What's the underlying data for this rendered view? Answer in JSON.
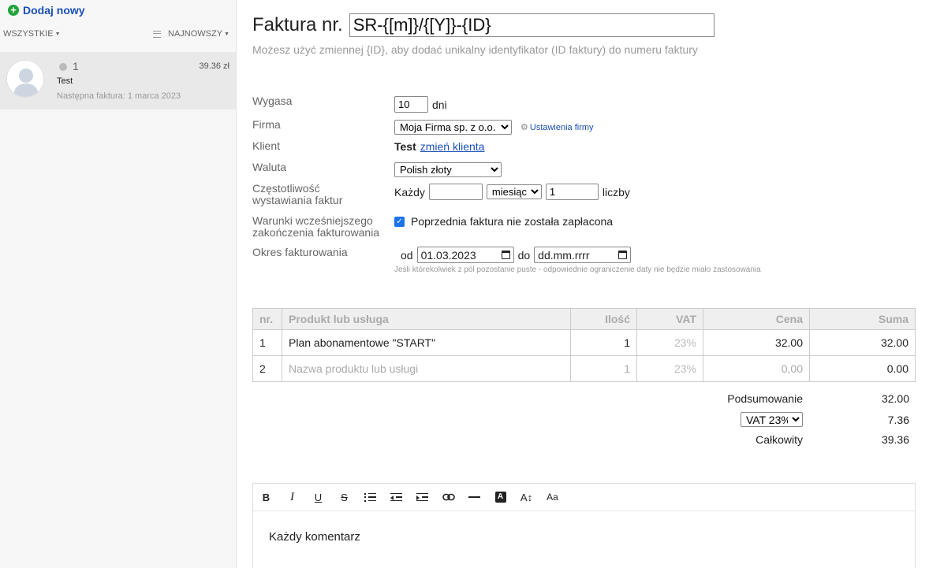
{
  "sidebar": {
    "add_new_label": "Dodaj nowy",
    "filter_label": "WSZYSTKIE",
    "sort_label": "NAJNOWSZY",
    "invoice": {
      "count": "1",
      "amount": "39.36 zł",
      "client_name": "Test",
      "next_invoice": "Następna faktura: 1 marca 2023"
    }
  },
  "main": {
    "title_label": "Faktura nr.",
    "invoice_number": "SR-{[m]}/{[Y]}-{ID}",
    "hint": "Możesz użyć zmiennej {ID}, aby dodać unikalny identyfikator (ID faktury) do numeru faktury"
  },
  "form": {
    "expires_label": "Wygasa",
    "expires_value": "10",
    "expires_unit": "dni",
    "company_label": "Firma",
    "company_value": "Moja Firma sp. z o.o.",
    "company_settings_link": "Ustawienia firmy",
    "client_label": "Klient",
    "client_value": "Test",
    "client_change_link": "zmień klienta",
    "currency_label": "Waluta",
    "currency_value": "Polish złoty",
    "frequency_label_1": "Częstotliwość",
    "frequency_label_2": "wystawiania faktur",
    "frequency_prefix": "Każdy",
    "frequency_every_value": "",
    "frequency_period": "miesiąc",
    "frequency_count": "1",
    "frequency_suffix": "liczby",
    "early_end_label_1": "Warunki wcześniejszego",
    "early_end_label_2": "zakończenia fakturowania",
    "early_end_checkbox": "Poprzednia faktura nie została zapłacona",
    "period_label": "Okres fakturowania",
    "period_from_label": "od",
    "period_from": "01.03.2023",
    "period_to_label": "do",
    "period_to": "dd.mm.rrrr",
    "period_note": "Jeśli którekolwiek z pól pozostanie puste - odpowiednie ograniczenie daty nie będzie miało zastosowania"
  },
  "table": {
    "headers": [
      "nr.",
      "Produkt lub usługa",
      "Ilość",
      "VAT",
      "Cena",
      "Suma"
    ],
    "rows": [
      {
        "nr": "1",
        "product": "Plan abonamentowe \"START\"",
        "qty": "1",
        "vat": "23%",
        "price": "32.00",
        "sum": "32.00"
      },
      {
        "nr": "2",
        "product": "Nazwa produktu lub usługi",
        "qty": "1",
        "vat": "23%",
        "price": "0,00",
        "sum": "0.00"
      }
    ]
  },
  "summary": {
    "subtotal_label": "Podsumowanie",
    "subtotal_value": "32.00",
    "vat_select": "VAT 23%",
    "vat_value": "7.36",
    "total_label": "Całkowity",
    "total_value": "39.36"
  },
  "editor": {
    "toolbar": {
      "bold": "B",
      "italic": "I",
      "underline": "U",
      "strike": "S",
      "font_color": "A",
      "font_size": "A↕",
      "font_family": "Aa"
    },
    "comment": "Każdy komentarz"
  },
  "colors": {
    "link": "#1a4fb5",
    "add_icon": "#22a33a",
    "checkbox": "#1a73e8"
  }
}
